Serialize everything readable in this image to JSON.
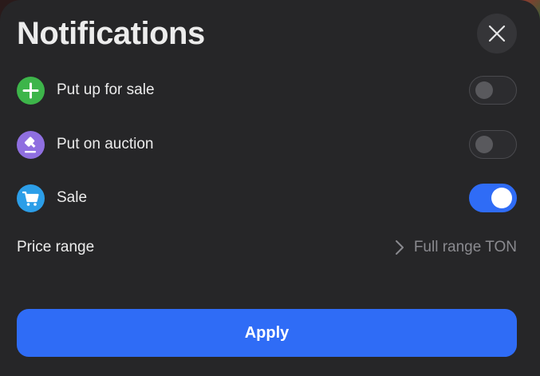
{
  "header": {
    "title": "Notifications",
    "close_icon": "close-icon"
  },
  "options": [
    {
      "label": "Put up for sale",
      "icon": "plus-icon",
      "icon_color": "#3db54a",
      "enabled": false
    },
    {
      "label": "Put on auction",
      "icon": "gavel-icon",
      "icon_color": "#8f6fe0",
      "enabled": false
    },
    {
      "label": "Sale",
      "icon": "cart-icon",
      "icon_color": "#2c9ee8",
      "enabled": true
    }
  ],
  "price_range": {
    "label": "Price range",
    "value": "Full range TON",
    "icon": "chevron-right-icon"
  },
  "footer": {
    "apply_label": "Apply"
  },
  "colors": {
    "accent": "#2f6cf6",
    "panel_background": "#262628"
  }
}
